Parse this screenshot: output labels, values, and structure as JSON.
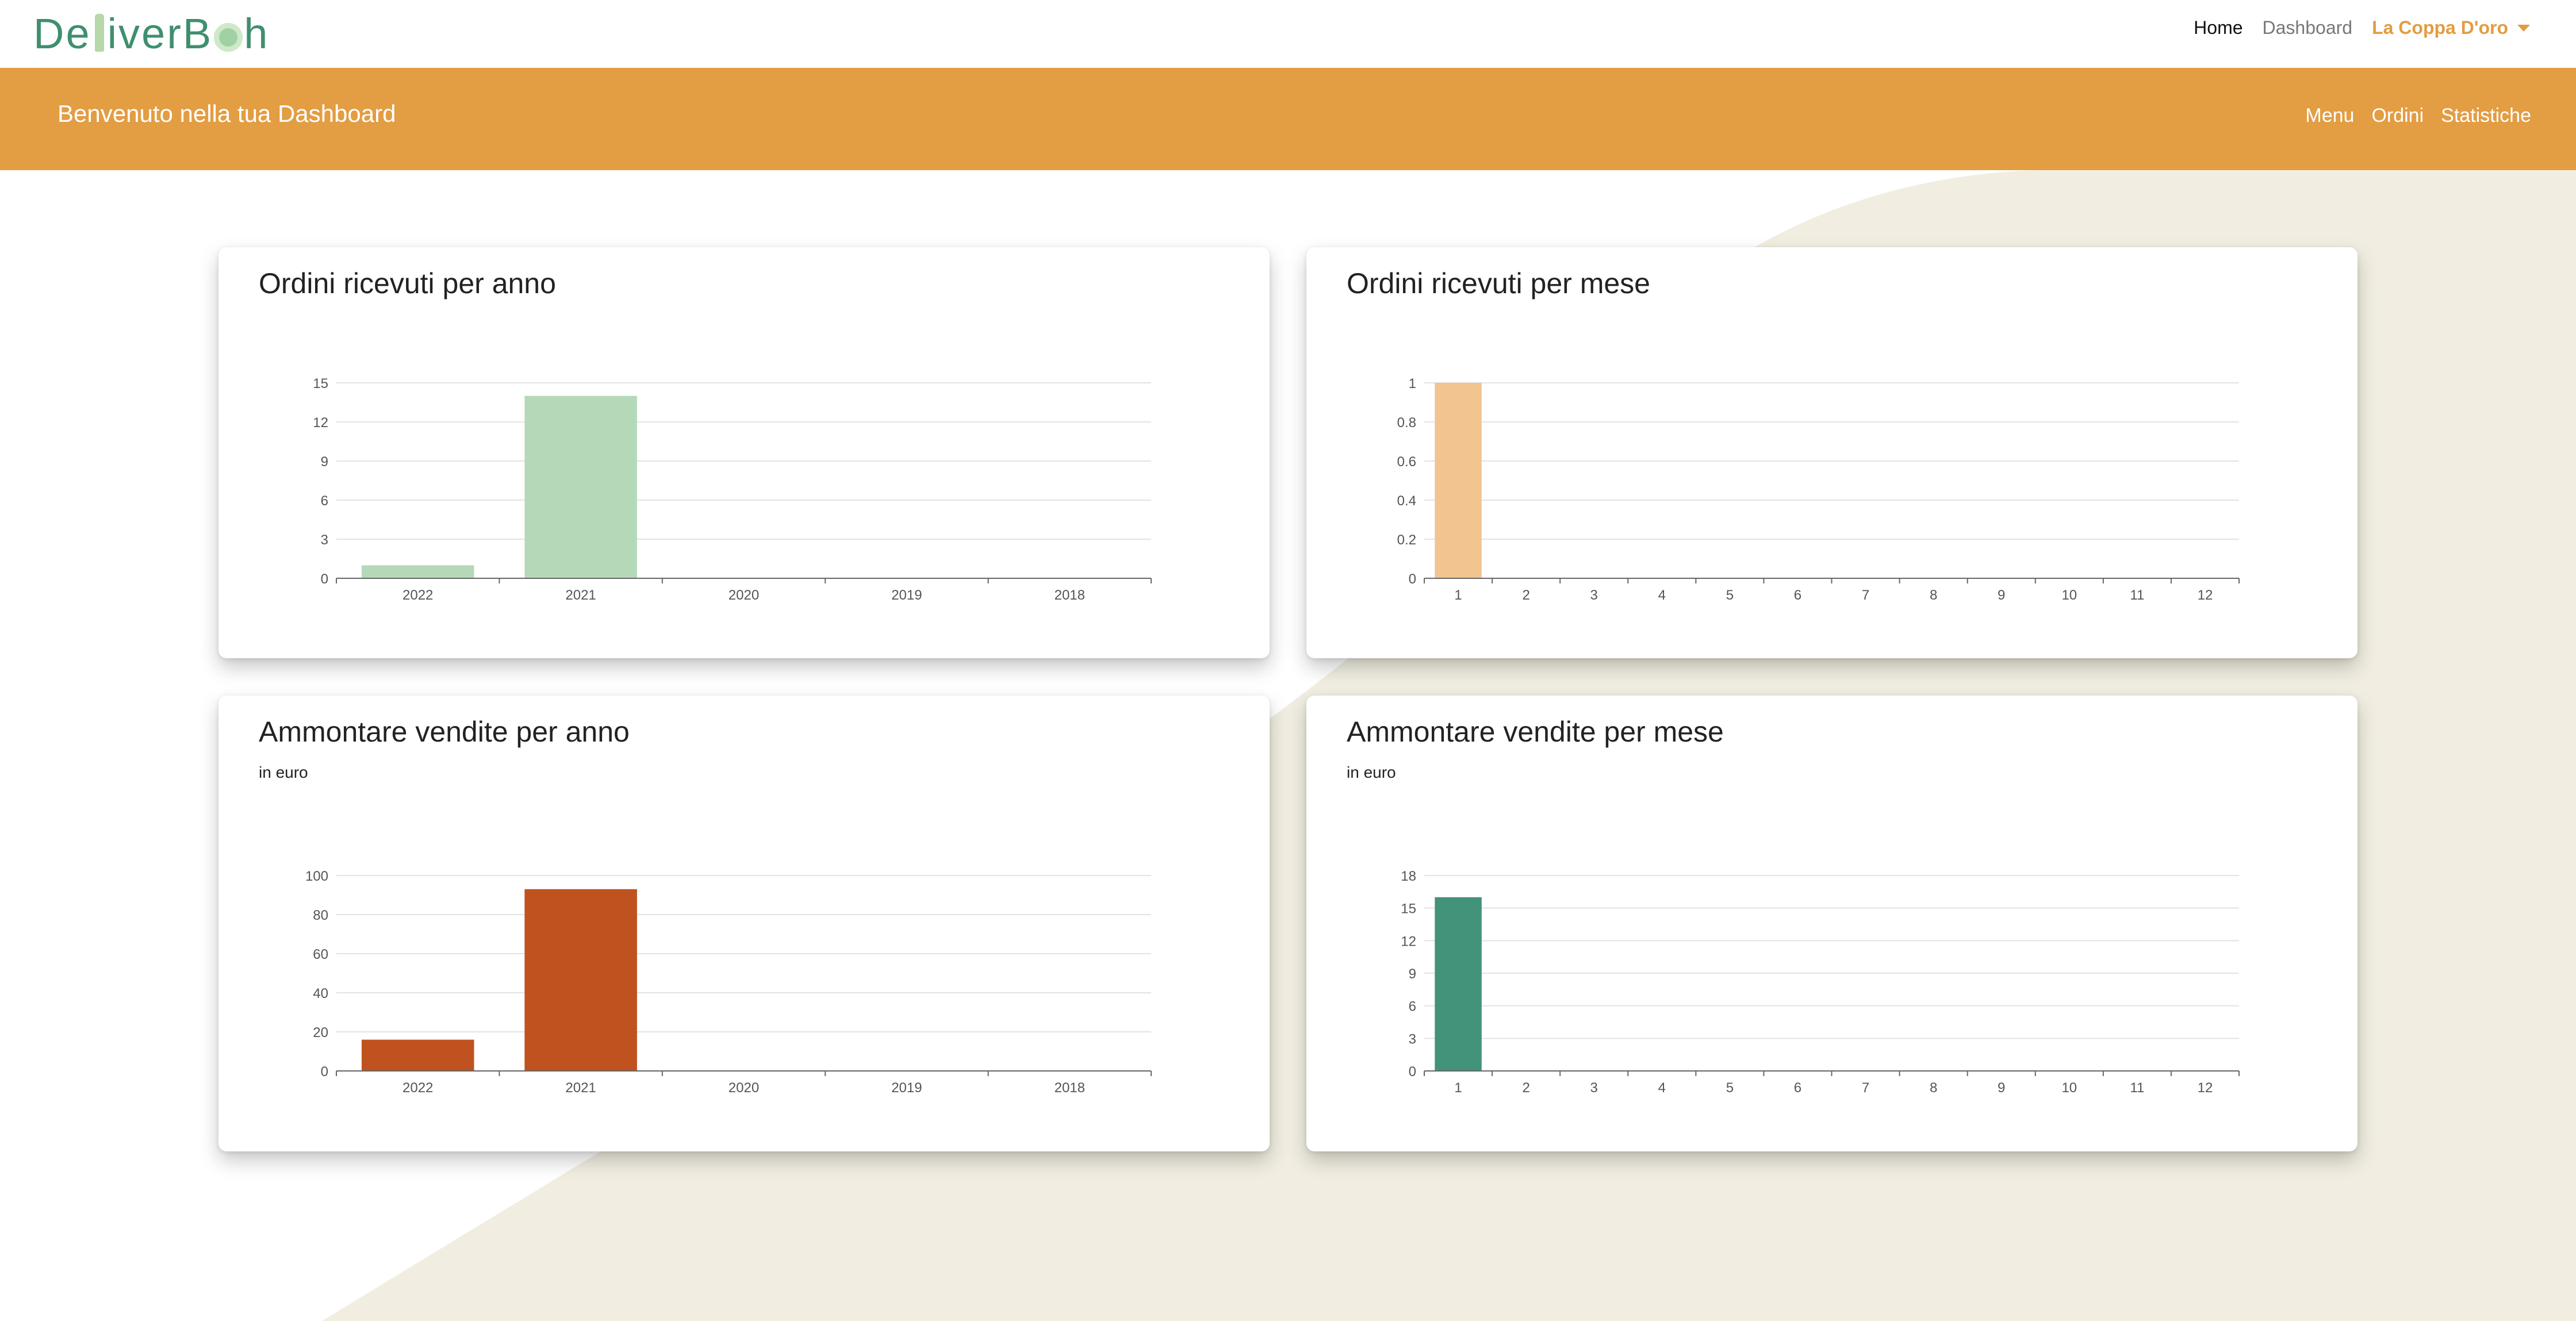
{
  "logo": {
    "text_a": "De",
    "text_b": "iverB",
    "text_c": "h"
  },
  "nav": {
    "home": "Home",
    "dashboard": "Dashboard",
    "user": "La Coppa D'oro"
  },
  "banner": {
    "title": "Benvenuto nella tua Dashboard",
    "links": [
      "Menu",
      "Ordini",
      "Statistiche"
    ]
  },
  "cards": [
    {
      "title": "Ordini ricevuti per anno",
      "subtitle": ""
    },
    {
      "title": "Ordini ricevuti per mese",
      "subtitle": ""
    },
    {
      "title": "Ammontare vendite per anno",
      "subtitle": "in euro"
    },
    {
      "title": "Ammontare vendite per mese",
      "subtitle": "in euro"
    }
  ],
  "colors": {
    "brand_green": "#3f8f6e",
    "banner_orange": "#e39d42",
    "user_orange": "#e39c41",
    "bar_light_green": "#b5d9b8",
    "bar_peach": "#f2c490",
    "bar_rust": "#c0521f",
    "bar_teal": "#43927a",
    "background_blob": "#f1eee1"
  },
  "chart_data": [
    {
      "type": "bar",
      "categories": [
        "2022",
        "2021",
        "2020",
        "2019",
        "2018"
      ],
      "values": [
        1,
        14,
        0,
        0,
        0
      ],
      "yticks": [
        "0",
        "3",
        "6",
        "9",
        "12",
        "15"
      ],
      "ylim": [
        0,
        15
      ],
      "grid": true,
      "color": "#b5d9b8"
    },
    {
      "type": "bar",
      "categories": [
        "1",
        "2",
        "3",
        "4",
        "5",
        "6",
        "7",
        "8",
        "9",
        "10",
        "11",
        "12"
      ],
      "values": [
        1,
        0,
        0,
        0,
        0,
        0,
        0,
        0,
        0,
        0,
        0,
        0
      ],
      "yticks": [
        "0",
        "0.2",
        "0.4",
        "0.6",
        "0.8",
        "1"
      ],
      "ylim": [
        0,
        1
      ],
      "grid": true,
      "color": "#f2c490"
    },
    {
      "type": "bar",
      "categories": [
        "2022",
        "2021",
        "2020",
        "2019",
        "2018"
      ],
      "values": [
        16,
        93,
        0,
        0,
        0
      ],
      "yticks": [
        "0",
        "20",
        "40",
        "60",
        "80",
        "100"
      ],
      "ylim": [
        0,
        100
      ],
      "grid": true,
      "color": "#c0521f"
    },
    {
      "type": "bar",
      "categories": [
        "1",
        "2",
        "3",
        "4",
        "5",
        "6",
        "7",
        "8",
        "9",
        "10",
        "11",
        "12"
      ],
      "values": [
        16,
        0,
        0,
        0,
        0,
        0,
        0,
        0,
        0,
        0,
        0,
        0
      ],
      "yticks": [
        "0",
        "3",
        "6",
        "9",
        "12",
        "15",
        "18"
      ],
      "ylim": [
        0,
        18
      ],
      "grid": true,
      "color": "#43927a"
    }
  ]
}
